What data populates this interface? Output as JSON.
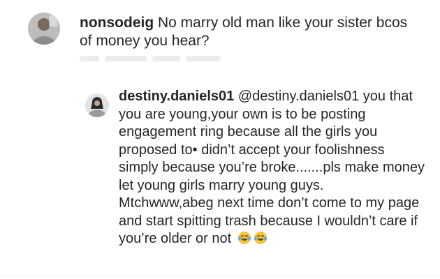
{
  "comments": [
    {
      "username": "nonsodeig",
      "text": " No marry old man like your sister bcos of money you hear?"
    },
    {
      "username": "destiny.daniels01",
      "mention": " @destiny.daniels01",
      "text": " you that you are young,your own is to be posting engagement ring because all the girls you proposed to• didn’t accept your foolishness simply because you’re broke.......pls make money let young girls marry young guys.",
      "text2": "Mtchwww,abeg next time don’t come to my page and start spitting trash because I wouldn’t care if you’re older or not",
      "emojis": [
        "tears-of-joy-icon",
        "tears-of-joy-icon"
      ]
    }
  ],
  "colors": {
    "text": "#262626",
    "background": "#ffffff",
    "emoji_face": "#f7c53a"
  }
}
